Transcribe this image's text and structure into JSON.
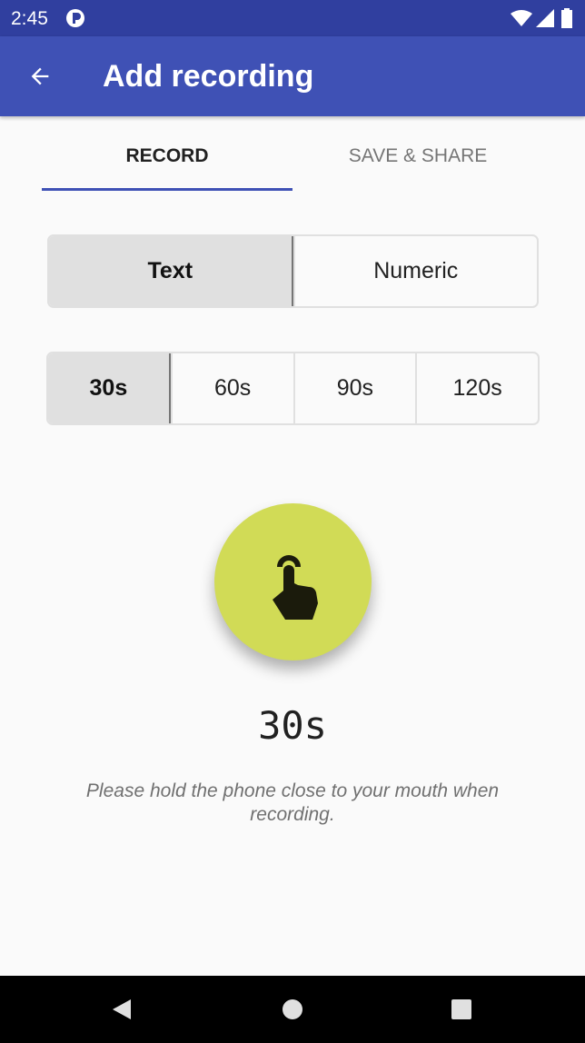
{
  "status_bar": {
    "time": "2:45"
  },
  "app_bar": {
    "title": "Add recording",
    "back_icon": "arrow-back-icon"
  },
  "tabs": [
    {
      "label": "RECORD",
      "selected": true
    },
    {
      "label": "SAVE & SHARE",
      "selected": false
    }
  ],
  "type_options": [
    {
      "label": "Text",
      "selected": true
    },
    {
      "label": "Numeric",
      "selected": false
    }
  ],
  "duration_options": [
    {
      "label": "30s",
      "selected": true
    },
    {
      "label": "60s",
      "selected": false
    },
    {
      "label": "90s",
      "selected": false
    },
    {
      "label": "120s",
      "selected": false
    }
  ],
  "record_button": {
    "icon": "touch-hand-icon",
    "color": "#d1db56"
  },
  "timer": "30s",
  "hint": "Please hold the phone close to your mouth when recording.",
  "colors": {
    "primary": "#3f51b5",
    "primary_dark": "#303f9f",
    "accent": "#d1db56"
  }
}
